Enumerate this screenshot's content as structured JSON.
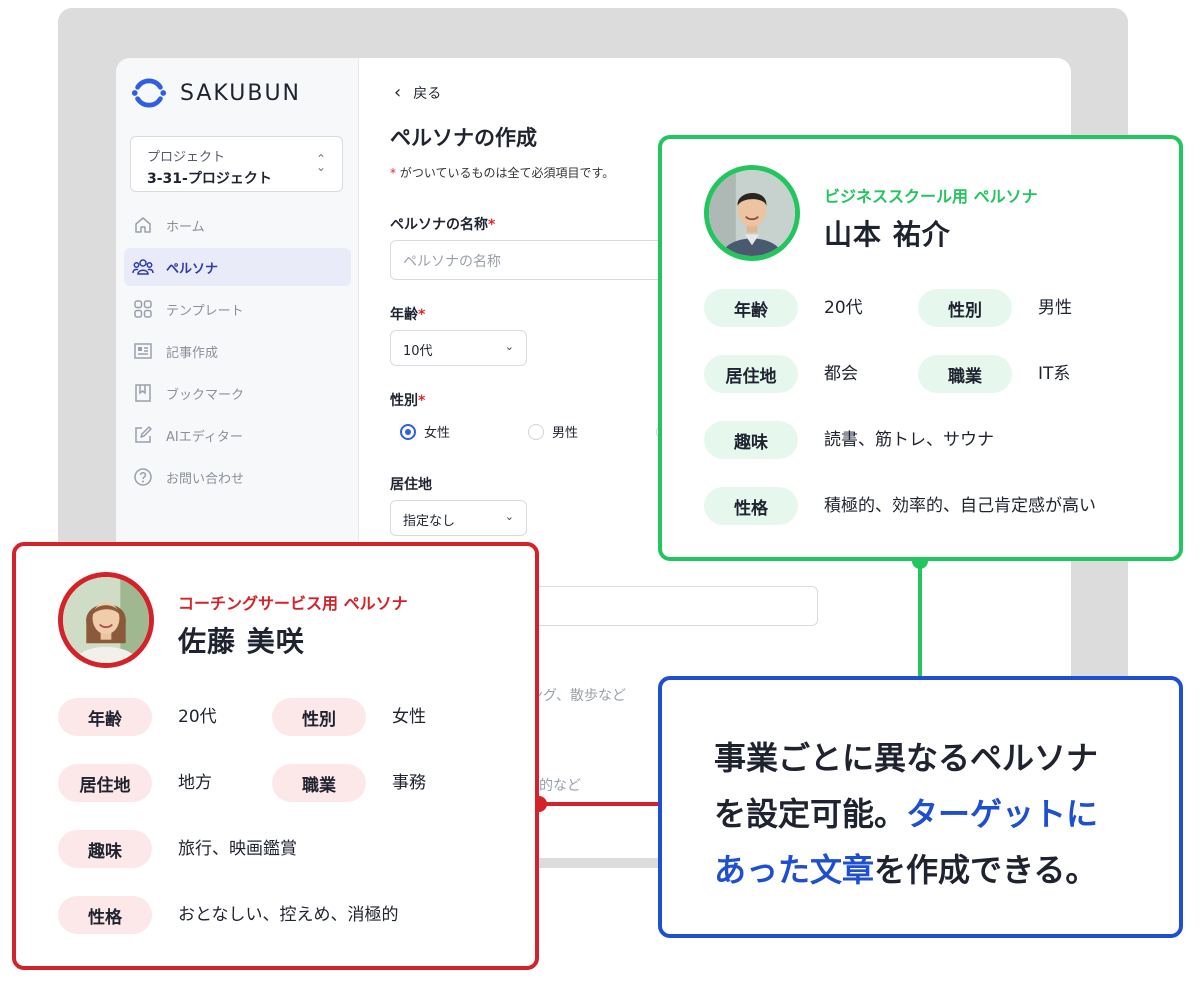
{
  "app": {
    "logo_text": "SAKUBUN"
  },
  "sidebar": {
    "project_label": "プロジェクト",
    "project_value": "3-31-プロジェクト",
    "items": [
      {
        "label": "ホーム",
        "icon": "home-icon"
      },
      {
        "label": "ペルソナ",
        "icon": "users-icon",
        "active": true
      },
      {
        "label": "テンプレート",
        "icon": "grid-icon"
      },
      {
        "label": "記事作成",
        "icon": "document-icon"
      },
      {
        "label": "ブックマーク",
        "icon": "bookmark-icon"
      },
      {
        "label": "AIエディター",
        "icon": "edit-icon"
      },
      {
        "label": "お問い合わせ",
        "icon": "help-icon"
      }
    ]
  },
  "form": {
    "back_label": "戻る",
    "title": "ペルソナの作成",
    "required_note": "がついているものは全て必須項目です。",
    "required_star": "*",
    "name_label": "ペルソナの名称",
    "name_placeholder": "ペルソナの名称",
    "age_label": "年齢",
    "age_value": "10代",
    "gender_label": "性別",
    "gender_options": [
      "女性",
      "男性"
    ],
    "gender_selected": "女性",
    "residence_label": "居住地",
    "residence_value": "指定なし",
    "hobby_placeholder_partial": "ギング、散歩など",
    "personality_placeholder_partial": "極的など"
  },
  "cards": {
    "green": {
      "subtitle": "ビジネススクール用 ペルソナ",
      "name": "山本 祐介",
      "accent": "#22c55e",
      "fields": {
        "age_label": "年齢",
        "age": "20代",
        "gender_label": "性別",
        "gender": "男性",
        "residence_label": "居住地",
        "residence": "都会",
        "job_label": "職業",
        "job": "IT系",
        "hobby_label": "趣味",
        "hobby": "読書、筋トレ、サウナ",
        "personality_label": "性格",
        "personality": "積極的、効率的、自己肯定感が高い"
      }
    },
    "red": {
      "subtitle": "コーチングサービス用 ペルソナ",
      "name": "佐藤 美咲",
      "accent": "#d3222a",
      "fields": {
        "age_label": "年齢",
        "age": "20代",
        "gender_label": "性別",
        "gender": "女性",
        "residence_label": "居住地",
        "residence": "地方",
        "job_label": "職業",
        "job": "事務",
        "hobby_label": "趣味",
        "hobby": "旅行、映画鑑賞",
        "personality_label": "性格",
        "personality": "おとなしい、控えめ、消極的"
      }
    },
    "blue": {
      "line1": "事業ごとに異なるペルソナ",
      "line2_plain": "を設定可能。",
      "line2_highlight": "ターゲットに",
      "line3_highlight": "あった文章",
      "line3_plain": "を作成できる。",
      "accent": "#1f4fd1"
    }
  }
}
